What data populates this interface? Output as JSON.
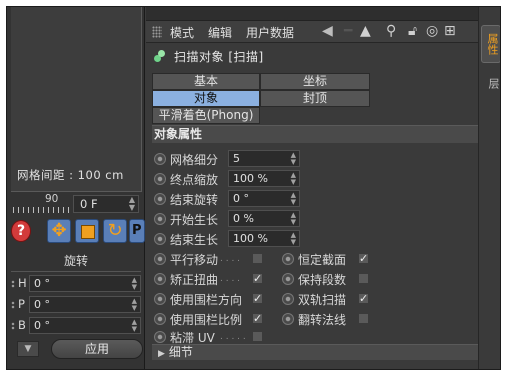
{
  "left_panel": {
    "viewport_status": "网格间距 : 100 cm",
    "ruler_value": "90",
    "frame_field": "0 F",
    "rotation_title": "旋转",
    "rotation_rows": [
      {
        "label": "H",
        "value": "0 °"
      },
      {
        "label": "P",
        "value": "0 °"
      },
      {
        "label": "B",
        "value": "0 °"
      }
    ],
    "apply_label": "应用"
  },
  "menubar": {
    "items": [
      "模式",
      "编辑",
      "用户数据"
    ]
  },
  "object": {
    "title": "扫描对象 [扫描]"
  },
  "tabs": {
    "basic": "基本",
    "coords": "坐标",
    "object": "对象",
    "caps": "封顶",
    "phong": "平滑着色(Phong)"
  },
  "section_title": "对象属性",
  "fields": [
    {
      "label": "网格细分",
      "value": "5"
    },
    {
      "label": "终点缩放",
      "value": "100 %"
    },
    {
      "label": "结束旋转",
      "value": "0 °"
    },
    {
      "label": "开始生长",
      "value": "0 %"
    },
    {
      "label": "结束生长",
      "value": "100 %"
    }
  ],
  "checks_left": [
    {
      "label": "平行移动",
      "dots": ". . . .",
      "checked": false
    },
    {
      "label": "矫正扭曲",
      "dots": ". . . .",
      "checked": true
    },
    {
      "label": "使用围栏方向",
      "dots": "",
      "checked": true
    },
    {
      "label": "使用围栏比例",
      "dots": "",
      "checked": true
    },
    {
      "label": "粘滞 UV",
      "dots": ". . . . .",
      "checked": false
    }
  ],
  "checks_right": [
    {
      "label": "恒定截面",
      "checked": true
    },
    {
      "label": "保持段数",
      "checked": false
    },
    {
      "label": "双轨扫描",
      "checked": true
    },
    {
      "label": "翻转法线",
      "checked": false
    }
  ],
  "detail_label": "细节",
  "side_tabs": [
    "属性",
    "层"
  ],
  "check_mark": "✓"
}
